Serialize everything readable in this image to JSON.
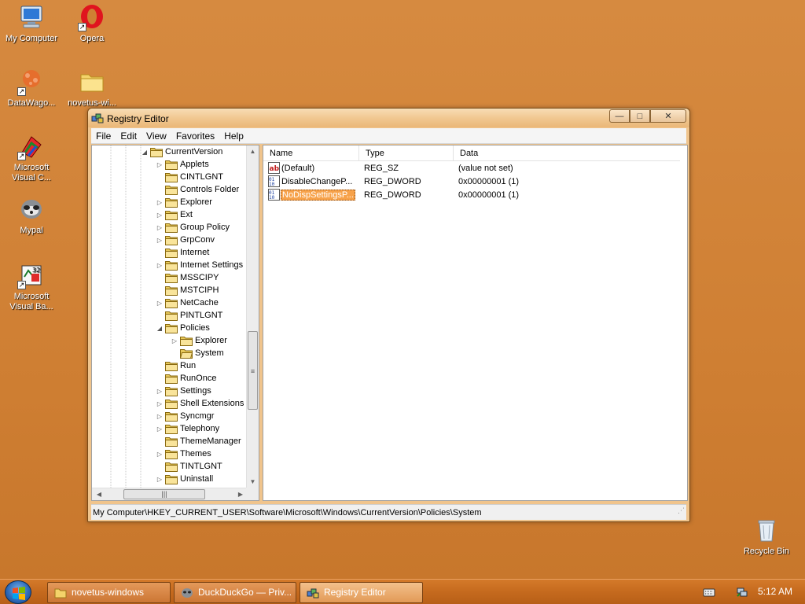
{
  "desktop": {
    "icons": [
      {
        "label": "My Computer"
      },
      {
        "label": "Opera"
      },
      {
        "label": "DataWago..."
      },
      {
        "label": "novetus-wi..."
      },
      {
        "label": "Microsoft Visual C..."
      },
      {
        "label": "Mypal"
      },
      {
        "label": "Microsoft Visual Ba..."
      },
      {
        "label": "Recycle Bin"
      }
    ]
  },
  "window": {
    "title": "Registry Editor",
    "minimize_label": "—",
    "maximize_label": "□",
    "close_label": "✕",
    "menu": [
      "File",
      "Edit",
      "View",
      "Favorites",
      "Help"
    ]
  },
  "tree": {
    "items": [
      {
        "label": "CurrentVersion",
        "level": 0,
        "expander": "◢"
      },
      {
        "label": "Applets",
        "level": 1,
        "expander": "▷"
      },
      {
        "label": "CINTLGNT",
        "level": 1,
        "expander": ""
      },
      {
        "label": "Controls Folder",
        "level": 1,
        "expander": ""
      },
      {
        "label": "Explorer",
        "level": 1,
        "expander": "▷"
      },
      {
        "label": "Ext",
        "level": 1,
        "expander": "▷"
      },
      {
        "label": "Group Policy",
        "level": 1,
        "expander": "▷"
      },
      {
        "label": "GrpConv",
        "level": 1,
        "expander": "▷"
      },
      {
        "label": "Internet",
        "level": 1,
        "expander": ""
      },
      {
        "label": "Internet Settings",
        "level": 1,
        "expander": "▷"
      },
      {
        "label": "MSSCIPY",
        "level": 1,
        "expander": ""
      },
      {
        "label": "MSTCIPH",
        "level": 1,
        "expander": ""
      },
      {
        "label": "NetCache",
        "level": 1,
        "expander": "▷"
      },
      {
        "label": "PINTLGNT",
        "level": 1,
        "expander": ""
      },
      {
        "label": "Policies",
        "level": 1,
        "expander": "◢"
      },
      {
        "label": "Explorer",
        "level": 2,
        "expander": "▷"
      },
      {
        "label": "System",
        "level": 2,
        "expander": "",
        "open": true
      },
      {
        "label": "Run",
        "level": 1,
        "expander": ""
      },
      {
        "label": "RunOnce",
        "level": 1,
        "expander": ""
      },
      {
        "label": "Settings",
        "level": 1,
        "expander": "▷"
      },
      {
        "label": "Shell Extensions",
        "level": 1,
        "expander": "▷"
      },
      {
        "label": "Syncmgr",
        "level": 1,
        "expander": "▷"
      },
      {
        "label": "Telephony",
        "level": 1,
        "expander": "▷"
      },
      {
        "label": "ThemeManager",
        "level": 1,
        "expander": ""
      },
      {
        "label": "Themes",
        "level": 1,
        "expander": "▷"
      },
      {
        "label": "TINTLGNT",
        "level": 1,
        "expander": ""
      },
      {
        "label": "Uninstall",
        "level": 1,
        "expander": "▷"
      }
    ],
    "scroll_up": "▲",
    "scroll_down": "▼",
    "scroll_left": "◀",
    "scroll_right": "▶",
    "vthumb_grip": "≡",
    "hthumb_grip": "|||"
  },
  "list": {
    "columns": [
      "Name",
      "Type",
      "Data"
    ],
    "rows": [
      {
        "name": "(Default)",
        "type": "REG_SZ",
        "data": "(value not set)",
        "icon": "string-value-icon",
        "selected": false
      },
      {
        "name": "DisableChangeP...",
        "type": "REG_DWORD",
        "data": "0x00000001 (1)",
        "icon": "binary-value-icon",
        "selected": false
      },
      {
        "name": "NoDispSettingsP...",
        "type": "REG_DWORD",
        "data": "0x00000001 (1)",
        "icon": "binary-value-icon",
        "selected": true
      }
    ]
  },
  "statusbar": {
    "path": "My Computer\\HKEY_CURRENT_USER\\Software\\Microsoft\\Windows\\CurrentVersion\\Policies\\System"
  },
  "taskbar": {
    "buttons": [
      {
        "label": "novetus-windows",
        "icon": "folder-icon",
        "active": false
      },
      {
        "label": "DuckDuckGo — Priv...",
        "icon": "mypal-icon",
        "active": false
      },
      {
        "label": "Registry Editor",
        "icon": "regedit-icon",
        "active": true
      }
    ],
    "clock": "5:12 AM"
  },
  "colors": {
    "desktop": "#d68a40",
    "selection": "#f7a24a",
    "taskbar": "#c56a1e"
  }
}
